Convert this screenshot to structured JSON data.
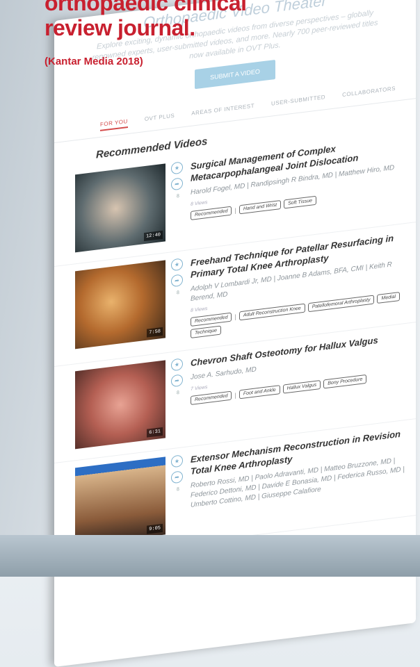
{
  "promo": {
    "title_line1": "orthopaedic clinical",
    "title_line2": "review journal.",
    "source": "(Kantar Media 2018)"
  },
  "site": {
    "hero_title": "Orthopaedic Video Theater",
    "hero_text": "Explore exciting, dynamic orthopaedic videos from diverse perspectives – globally renowned experts, user-submitted videos, and more. Nearly 700 peer-reviewed titles now available in OVT Plus.",
    "submit_label": "SUBMIT A VIDEO",
    "tabs": [
      "FOR YOU",
      "OVT PLUS",
      "AREAS OF INTEREST",
      "USER-SUBMITTED",
      "COLLABORATORS"
    ],
    "active_tab": 0,
    "section_title": "Recommended Videos"
  },
  "videos": [
    {
      "title": "Surgical Management of Complex Metacarpophalangeal Joint Dislocation",
      "authors": "Harold Fogel, MD | Randipsingh R Bindra, MD | Matthew Hiro, MD",
      "views": "8 Views",
      "duration": "12:40",
      "tags": [
        "Recommended",
        "Hand and Wrist",
        "Soft Tissue"
      ]
    },
    {
      "title": "Freehand Technique for Patellar Resurfacing in Primary Total Knee Arthroplasty",
      "authors": "Adolph V Lombardi Jr, MD | Joanne B Adams, BFA, CMI | Keith R Berend, MD",
      "views": "8 Views",
      "duration": "7:58",
      "tags": [
        "Recommended",
        "Adult Reconstruction Knee",
        "Patellofemoral Arthroplasty",
        "Medial",
        "Technique"
      ]
    },
    {
      "title": "Chevron Shaft Osteotomy for Hallux Valgus",
      "authors": "Jose A. Sarhudo, MD",
      "views": "7 Views",
      "duration": "6:31",
      "tags": [
        "Recommended",
        "Foot and Ankle",
        "Hallux Valgus",
        "Bony Procedure"
      ]
    },
    {
      "title": "Extensor Mechanism Reconstruction in Revision Total Knee Arthroplasty",
      "authors": "Roberto Rossi, MD | Paolo Adravanti, MD | Matteo Bruzzone, MD | Federico Dettoni, MD | Davide E Bonasia, MD | Federica Russo, MD | Umberto Cottino, MD | Giuseppe Calafiore",
      "views": "",
      "duration": "9:05",
      "tags": []
    }
  ]
}
